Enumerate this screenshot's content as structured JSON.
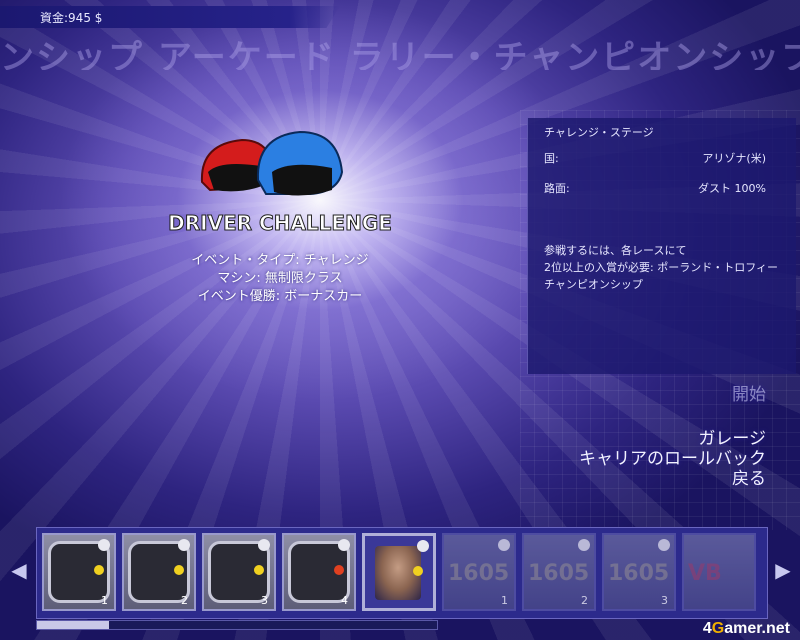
{
  "funds": {
    "label": "資金:945 $"
  },
  "banner": {
    "text": "ンシップ アーケード ラリー・チャンピオンシップ アーケード ラリ"
  },
  "logo": {
    "text": "DRIVER CHALLENGE",
    "helmet_colors": [
      "#e02020",
      "#2a7fe0"
    ]
  },
  "event": {
    "type": "イベント・タイプ: チャレンジ",
    "machine": "マシン: 無制限クラス",
    "prize": "イベント優勝: ボーナスカー"
  },
  "stage_panel": {
    "title": "チャレンジ・ステージ",
    "country_label": "国:",
    "country_value": "アリゾナ(米)",
    "surface_label": "路面:",
    "surface_value": "ダスト 100%",
    "note": [
      "参戦するには、各レースにて",
      "2位以上の入賞が必要: ポーランド・トロフィー",
      "チャンピオンシップ"
    ]
  },
  "menu": {
    "start": "開始",
    "garage": "ガレージ",
    "rollback": "キャリアのロールバック",
    "back": "戻る"
  },
  "cards": [
    {
      "num": "1"
    },
    {
      "num": "2"
    },
    {
      "num": "3"
    },
    {
      "num": "4"
    },
    {
      "num": ""
    },
    {
      "num": "1",
      "code": "1605"
    },
    {
      "num": "2",
      "code": "1605"
    },
    {
      "num": "3",
      "code": "1605"
    },
    {
      "num": "",
      "code": "VB"
    }
  ],
  "progress": {
    "fraction": 0.18
  },
  "watermark": {
    "pre": "4",
    "g": "G",
    "post": "amer.net"
  }
}
